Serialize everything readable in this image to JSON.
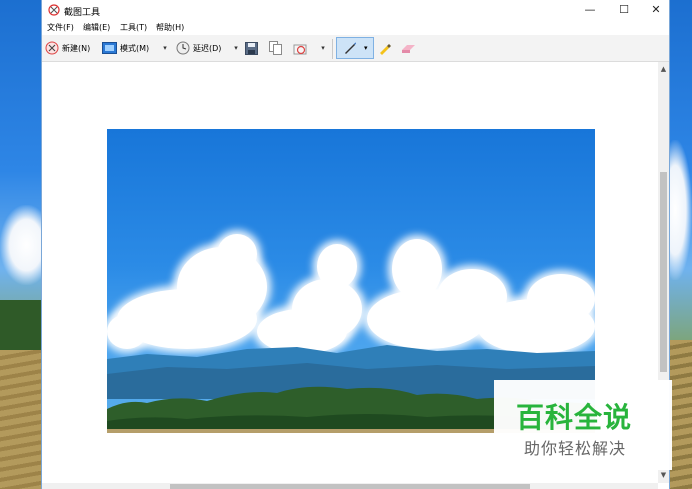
{
  "window": {
    "title": "截图工具",
    "controls": {
      "minimize": "—",
      "maximize": "☐",
      "close": "✕"
    }
  },
  "menu": [
    {
      "label": "文件(F)"
    },
    {
      "label": "编辑(E)"
    },
    {
      "label": "工具(T)"
    },
    {
      "label": "帮助(H)"
    }
  ],
  "toolbar": {
    "new_label": "新建(N)",
    "mode_label": "模式(M)",
    "delay_label": "延迟(D)",
    "dropdown_glyph": "▾"
  },
  "watermark": {
    "title": "百科全说",
    "subtitle": "助你轻松解决"
  },
  "colors": {
    "watermark_green": "#28b43c",
    "pen_highlight": "#cde3f7"
  }
}
